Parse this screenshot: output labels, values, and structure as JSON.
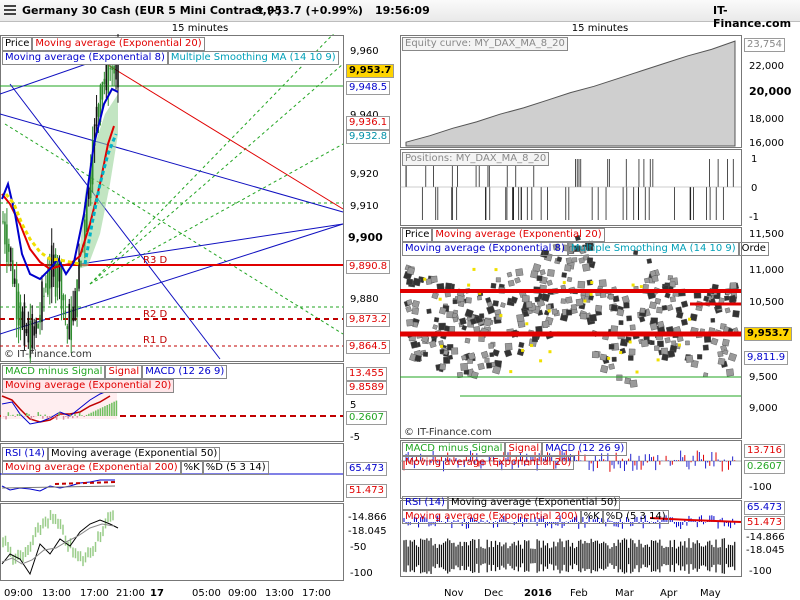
{
  "header": {
    "instrument": "Germany 30 Cash (EUR 5 Mini Contract (-)",
    "price_change": "9,953.7 (+0.99%)",
    "time": "19:56:09",
    "site": "IT-Finance.com",
    "menu_icon": "hamburger-menu-icon"
  },
  "left": {
    "timeframe": "15 minutes",
    "watermark": "© IT-Finance.com",
    "price_legend": [
      "Price",
      "Moving average (Exponential 20)",
      "Moving average (Exponential 8)",
      "Multiple Smoothing MA (14 10 9)"
    ],
    "price_axis": [
      "9,960",
      "9,940",
      "9,920",
      "9,910",
      "9,900",
      "9,880"
    ],
    "price_tags": [
      "9,953.7",
      "9,948.5",
      "9,936.1",
      "9,932.8",
      "9,890.8",
      "9,873.2",
      "9,864.5"
    ],
    "pivots": [
      "R3 D",
      "R2 D",
      "R1 D"
    ],
    "macd_legend": [
      "MACD minus Signal",
      "Signal",
      "MACD (12 26 9)",
      "Moving average (Exponential 20)"
    ],
    "macd_axis": [
      "13.455",
      "9.8589",
      "0.2607",
      "5",
      "-5"
    ],
    "rsi_legend": [
      "RSI (14)",
      "Moving average (Exponential 50)",
      "Moving average (Exponential 200)",
      "%K",
      "%D (5 3 14)"
    ],
    "rsi_axis": [
      "65.473",
      "51.473"
    ],
    "stoch_axis": [
      "-14.866",
      "-18.045",
      "-50",
      "-100"
    ],
    "time_axis": [
      "09:00",
      "13:00",
      "17:00",
      "21:00",
      "17",
      "05:00",
      "09:00",
      "13:00",
      "17:00"
    ]
  },
  "right": {
    "timeframe": "15 minutes",
    "equity_legend": "Equity curve: MY_DAX_MA_8_20",
    "equity_axis": [
      "23,754",
      "22,000",
      "20,000",
      "18,000",
      "16,000"
    ],
    "positions_legend": "Positions: MY_DAX_MA_8_20",
    "positions_axis": [
      "1",
      "0",
      "-1"
    ],
    "price_legend": [
      "Price",
      "Moving average (Exponential 20)",
      "Moving average (Exponential 8)",
      "Multiple Smoothing MA (14 10 9)",
      "Orde"
    ],
    "price_axis": [
      "11,500",
      "11,000",
      "10,500",
      "10,000",
      "9,500",
      "9,000"
    ],
    "price_tags": [
      "9,953.7",
      "9,811.9"
    ],
    "watermark": "© IT-Finance.com",
    "macd_legend": [
      "MACD minus Signal",
      "Signal",
      "MACD (12 26 9)",
      "Moving average (Exponential 20)"
    ],
    "macd_axis": [
      "13.716",
      "0.2607",
      "-100"
    ],
    "rsi_legend": [
      "RSI (14)",
      "Moving average (Exponential 50)",
      "Moving average (Exponential 200)",
      "%K",
      "%D (5 3 14)"
    ],
    "rsi_axis": [
      "65.473",
      "51.473",
      "-14.866",
      "-18.045",
      "-100"
    ],
    "time_axis": [
      "Nov",
      "Dec",
      "2016",
      "Feb",
      "Mar",
      "Apr",
      "May"
    ]
  },
  "chart_data": [
    {
      "type": "line",
      "title": "Germany 30 Cash — 15 minutes",
      "series": [
        {
          "name": "Price",
          "values": [
            9905,
            9895,
            9880,
            9870,
            9868,
            9872,
            9885,
            9890,
            9888,
            9870,
            9876,
            9895,
            9915,
            9938,
            9950,
            9955,
            9953.7
          ]
        }
      ],
      "ylim": [
        9860,
        9965
      ]
    },
    {
      "type": "area",
      "title": "Equity curve: MY_DAX_MA_8_20",
      "values": [
        15800,
        16300,
        16900,
        17400,
        18000,
        18500,
        19100,
        19700,
        20200,
        20800,
        21400,
        22000,
        22600,
        23100,
        23754
      ],
      "ylim": [
        15500,
        24000
      ]
    }
  ],
  "colors": {
    "ma20": "#e00000",
    "ma8": "#0000cc",
    "msma": "#00b4c8",
    "up": "#6fbf5f",
    "grid": "#00a000"
  }
}
